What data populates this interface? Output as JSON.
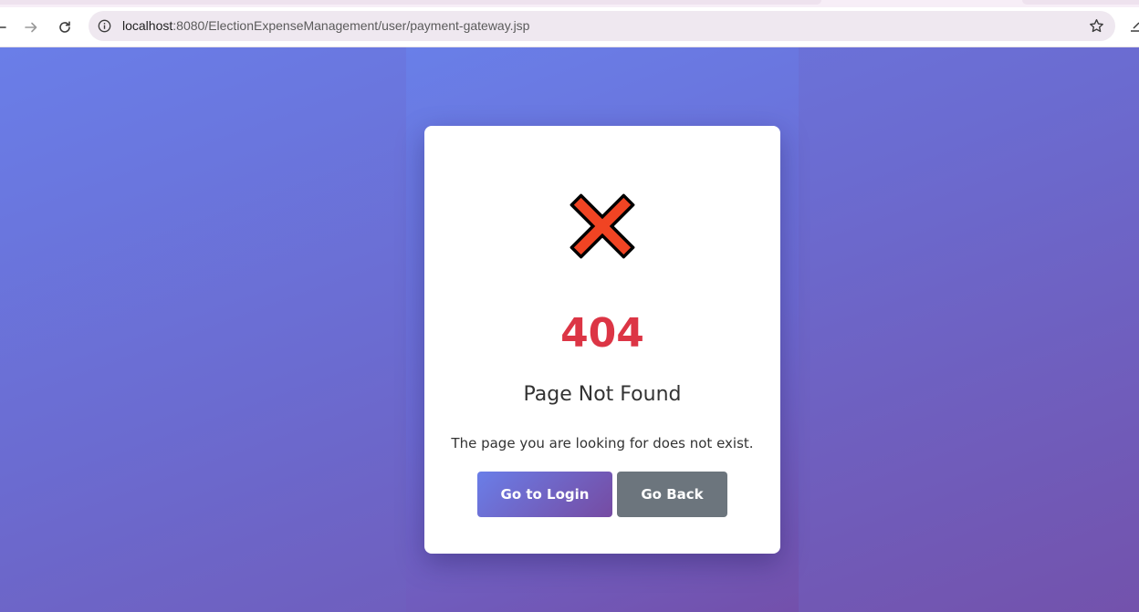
{
  "browser": {
    "url_host": "localhost",
    "url_rest": ":8080/ElectionExpenseManagement/user/payment-gateway.jsp"
  },
  "icons": {
    "back": "arrow-left-icon",
    "forward": "arrow-right-icon",
    "reload": "reload-icon",
    "site_info": "info-icon",
    "bookmark": "star-icon",
    "extension": "extension-icon",
    "error": "red-cross-icon"
  },
  "colors": {
    "accent": "#667eea",
    "error": "#dc3545",
    "secondary_button": "#6c757d"
  },
  "error_card": {
    "code": "404",
    "title": "Page Not Found",
    "message": "The page you are looking for does not exist.",
    "primary_button": "Go to Login",
    "secondary_button": "Go Back"
  }
}
